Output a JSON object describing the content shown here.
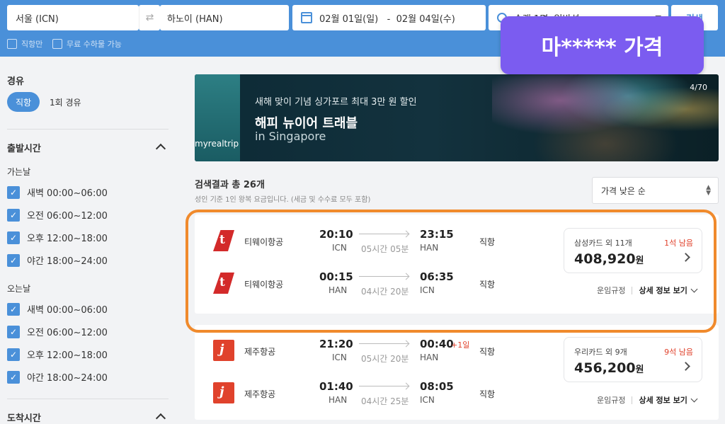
{
  "search": {
    "origin": "서울 (ICN)",
    "destination": "하노이 (HAN)",
    "dates": "02월 01일(일)   -  02월 04일(수)",
    "passengers": "승객 1명, 일반석",
    "search_button": "검색",
    "direct_only": "직항만",
    "free_baggage": "무료 수하물 가능"
  },
  "overlay_badge": "마***** 가격",
  "filters": {
    "stops_title": "경유",
    "stops_options": [
      "직항",
      "1회 경유"
    ],
    "departure_title": "출발시간",
    "outbound_label": "가는날",
    "return_label": "오는날",
    "time_slots": [
      "새벽 00:00~06:00",
      "오전 06:00~12:00",
      "오후 12:00~18:00",
      "야간 18:00~24:00"
    ],
    "arrival_title": "도착시간"
  },
  "banner": {
    "subtitle": "새해 맞이 기념 싱가포르 최대 3만 원 할인",
    "title": "해피 뉴이어 트래블",
    "title2": "in Singapore",
    "brand": "myrealtrip",
    "counter": "4/70"
  },
  "results": {
    "title": "검색결과 총 26개",
    "note": "성인 기준 1인 왕복 요금입니다. (세금 및 수수료 모두 포함)",
    "sort": "가격 낮은 순",
    "fare_rules": "운임규정",
    "details": "상세 정보 보기",
    "items": [
      {
        "legs": [
          {
            "airline": "티웨이항공",
            "dep_time": "20:10",
            "dep_code": "ICN",
            "duration": "05시간 05분",
            "arr_time": "23:15",
            "arr_code": "HAN",
            "stops": "직항",
            "plus_day": ""
          },
          {
            "airline": "티웨이항공",
            "dep_time": "00:15",
            "dep_code": "HAN",
            "duration": "04시간 20분",
            "arr_time": "06:35",
            "arr_code": "ICN",
            "stops": "직항",
            "plus_day": ""
          }
        ],
        "card_offer": "삼성카드 외 11개",
        "seats_left": "1석 남음",
        "price": "408,920",
        "currency": "원"
      },
      {
        "legs": [
          {
            "airline": "제주항공",
            "dep_time": "21:20",
            "dep_code": "ICN",
            "duration": "05시간 20분",
            "arr_time": "00:40",
            "arr_code": "HAN",
            "stops": "직항",
            "plus_day": "+1일"
          },
          {
            "airline": "제주항공",
            "dep_time": "01:40",
            "dep_code": "HAN",
            "duration": "04시간 25분",
            "arr_time": "08:05",
            "arr_code": "ICN",
            "stops": "직항",
            "plus_day": ""
          }
        ],
        "card_offer": "우리카드 외 9개",
        "seats_left": "9석 남음",
        "price": "456,200",
        "currency": "원"
      }
    ]
  },
  "colors": {
    "primary": "#4a90d9",
    "highlight": "#f08a2c",
    "badge": "#7b5cf0",
    "alert": "#e0422c"
  }
}
